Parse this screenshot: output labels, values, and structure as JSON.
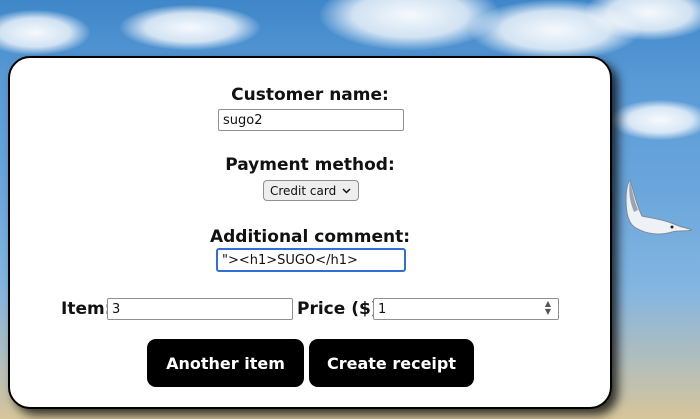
{
  "form": {
    "customer_label": "Customer name:",
    "customer_value": "sugo2",
    "payment_label": "Payment method:",
    "payment_selected": "Credit card",
    "comment_label": "Additional comment:",
    "comment_value": "\"><h1>SUGO</h1>",
    "item_label": "Item:",
    "item_value": "3",
    "price_label": "Price ($):",
    "price_value": "1"
  },
  "buttons": {
    "another_item": "Another item",
    "create_receipt": "Create receipt"
  },
  "colors": {
    "button_bg": "#000000",
    "focus_ring": "#2f6fd6"
  }
}
